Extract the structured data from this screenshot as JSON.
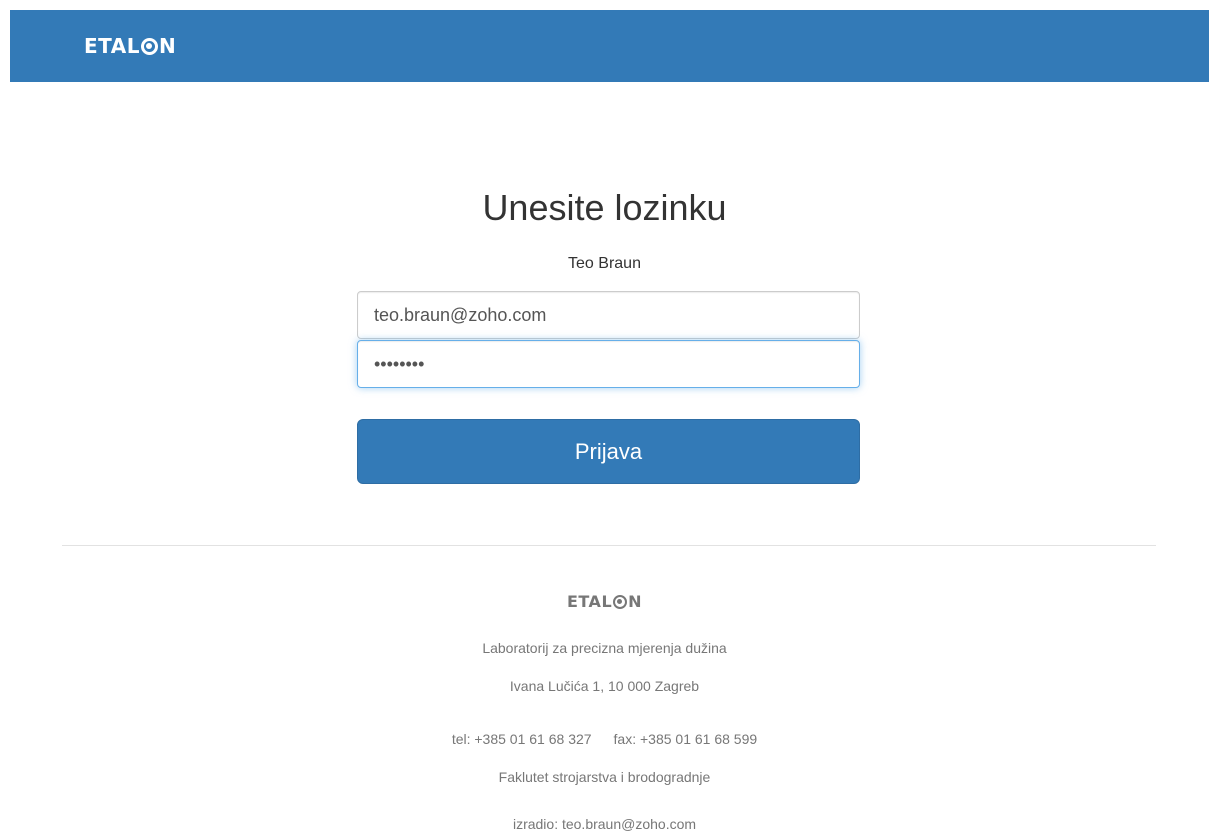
{
  "header": {
    "brand_left": "ETAL",
    "brand_right": "N",
    "bg_color": "#337ab7"
  },
  "login": {
    "title": "Unesite lozinku",
    "user_name": "Teo Braun",
    "email_value": "teo.braun@zoho.com",
    "password_value": "password",
    "submit_label": "Prijava",
    "accent_color": "#337ab7"
  },
  "footer": {
    "brand_left": "ETAL",
    "brand_right": "N",
    "lab_name": "Laboratorij za precizna mjerenja dužina",
    "address": "Ivana Lučića 1, 10 000 Zagreb",
    "tel": "tel: +385 01 61 68 327",
    "fax": "fax: +385 01 61 68 599",
    "faculty": "Faklutet strojarstva i brodogradnje",
    "author": "izradio: teo.braun@zoho.com"
  }
}
